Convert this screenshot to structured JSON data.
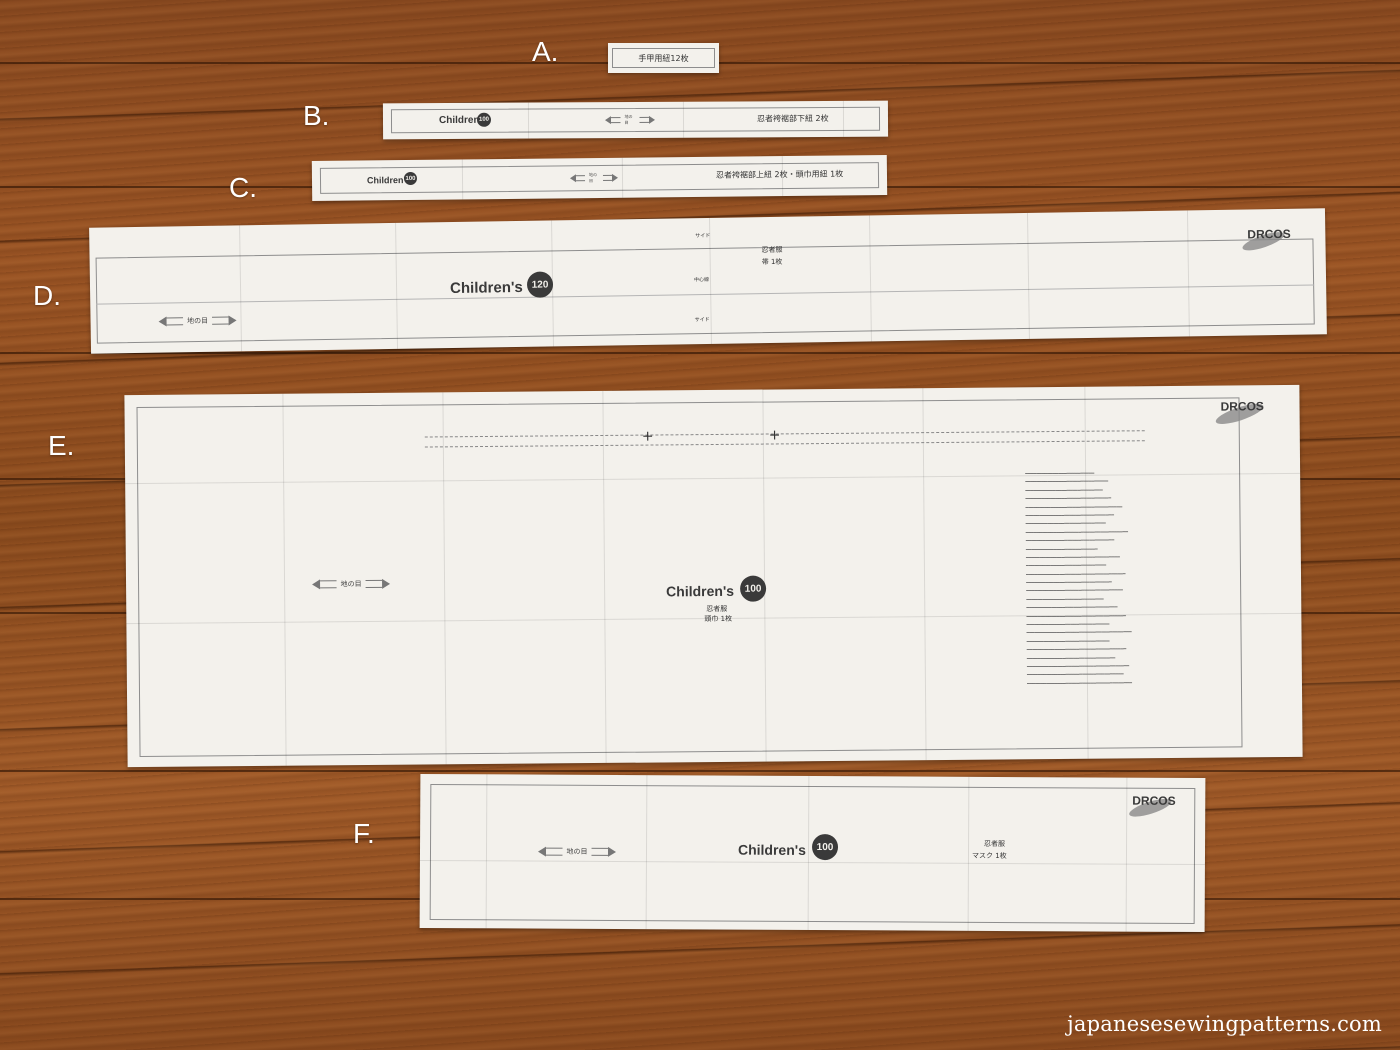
{
  "labels": {
    "a": "A.",
    "b": "B.",
    "c": "C.",
    "d": "D.",
    "e": "E.",
    "f": "F."
  },
  "piece_a": {
    "title": "手甲用紐12枚"
  },
  "piece_b": {
    "brand": "Children's",
    "size": "100",
    "grain": "地の目",
    "title": "忍者袴裾部下紐 2枚"
  },
  "piece_c": {
    "brand": "Children's",
    "size": "100",
    "grain": "地の目",
    "title": "忍者袴裾部上紐 2枚・頭巾用紐 1枚"
  },
  "piece_d": {
    "brand": "Children's",
    "size": "120",
    "grain": "地の目",
    "title": "忍者服",
    "subtitle": "帯 1枚",
    "side_top": "サイド",
    "side_bottom": "サイド",
    "center": "中心線",
    "logo": "DRCOS"
  },
  "piece_e": {
    "brand": "Children's",
    "size": "100",
    "grain": "地の目",
    "title": "忍者服",
    "subtitle": "頭巾 1枚",
    "logo": "DRCOS"
  },
  "piece_f": {
    "brand": "Children's",
    "size": "100",
    "grain": "地の目",
    "title": "忍者服",
    "subtitle": "マスク 1枚",
    "logo": "DRCOS"
  },
  "watermark": "japanesesewingpatterns.com"
}
